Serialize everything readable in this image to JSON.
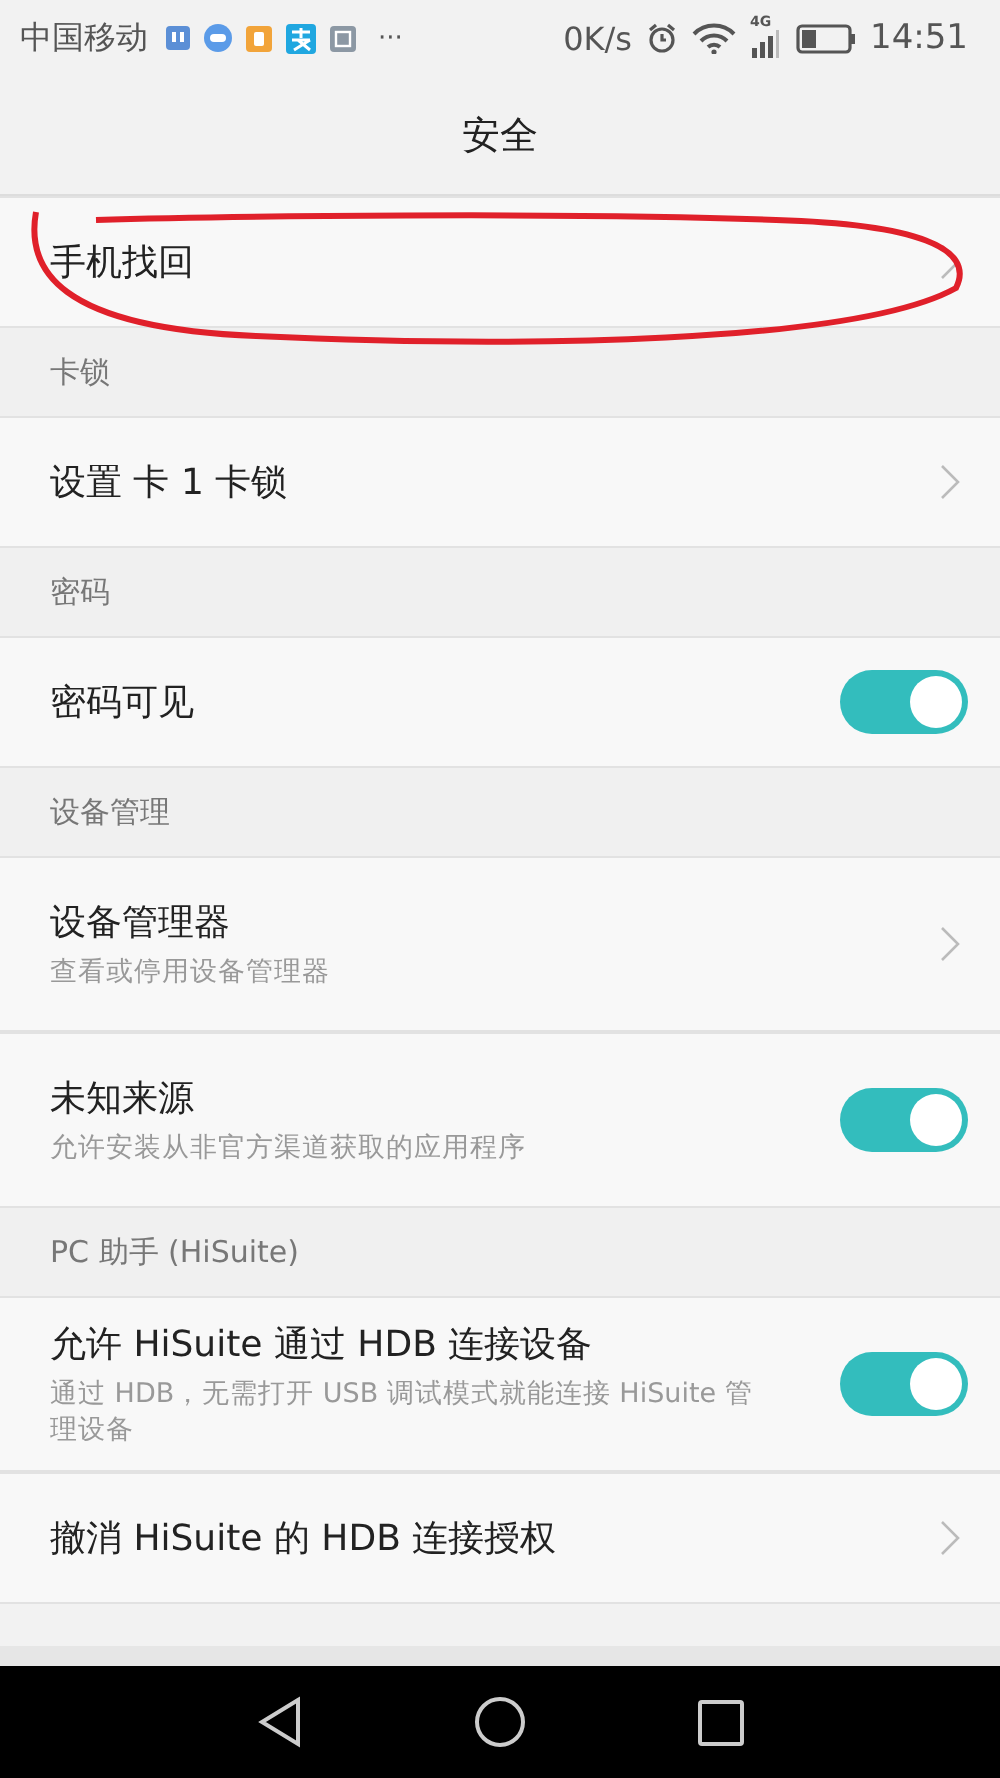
{
  "status_bar": {
    "carrier": "中国移动",
    "more": "···",
    "speed": "0K/s",
    "network": "4G",
    "time": "14:51"
  },
  "title": "安全",
  "items": [
    {
      "kind": "link",
      "title": "手机找回"
    },
    {
      "kind": "header",
      "title": "卡锁"
    },
    {
      "kind": "link",
      "title": "设置 卡 1 卡锁"
    },
    {
      "kind": "header",
      "title": "密码"
    },
    {
      "kind": "toggle",
      "title": "密码可见",
      "on": true
    },
    {
      "kind": "header",
      "title": "设备管理"
    },
    {
      "kind": "link",
      "title": "设备管理器",
      "subtitle": "查看或停用设备管理器"
    },
    {
      "kind": "toggle",
      "title": "未知来源",
      "subtitle": "允许安装从非官方渠道获取的应用程序",
      "on": true
    },
    {
      "kind": "header",
      "title": "PC 助手 (HiSuite)"
    },
    {
      "kind": "toggle",
      "title": "允许 HiSuite 通过 HDB 连接设备",
      "subtitle": "通过 HDB，无需打开 USB 调试模式就能连接 HiSuite 管理设备",
      "on": true
    },
    {
      "kind": "link",
      "title": "撤消 HiSuite 的 HDB 连接授权"
    }
  ]
}
